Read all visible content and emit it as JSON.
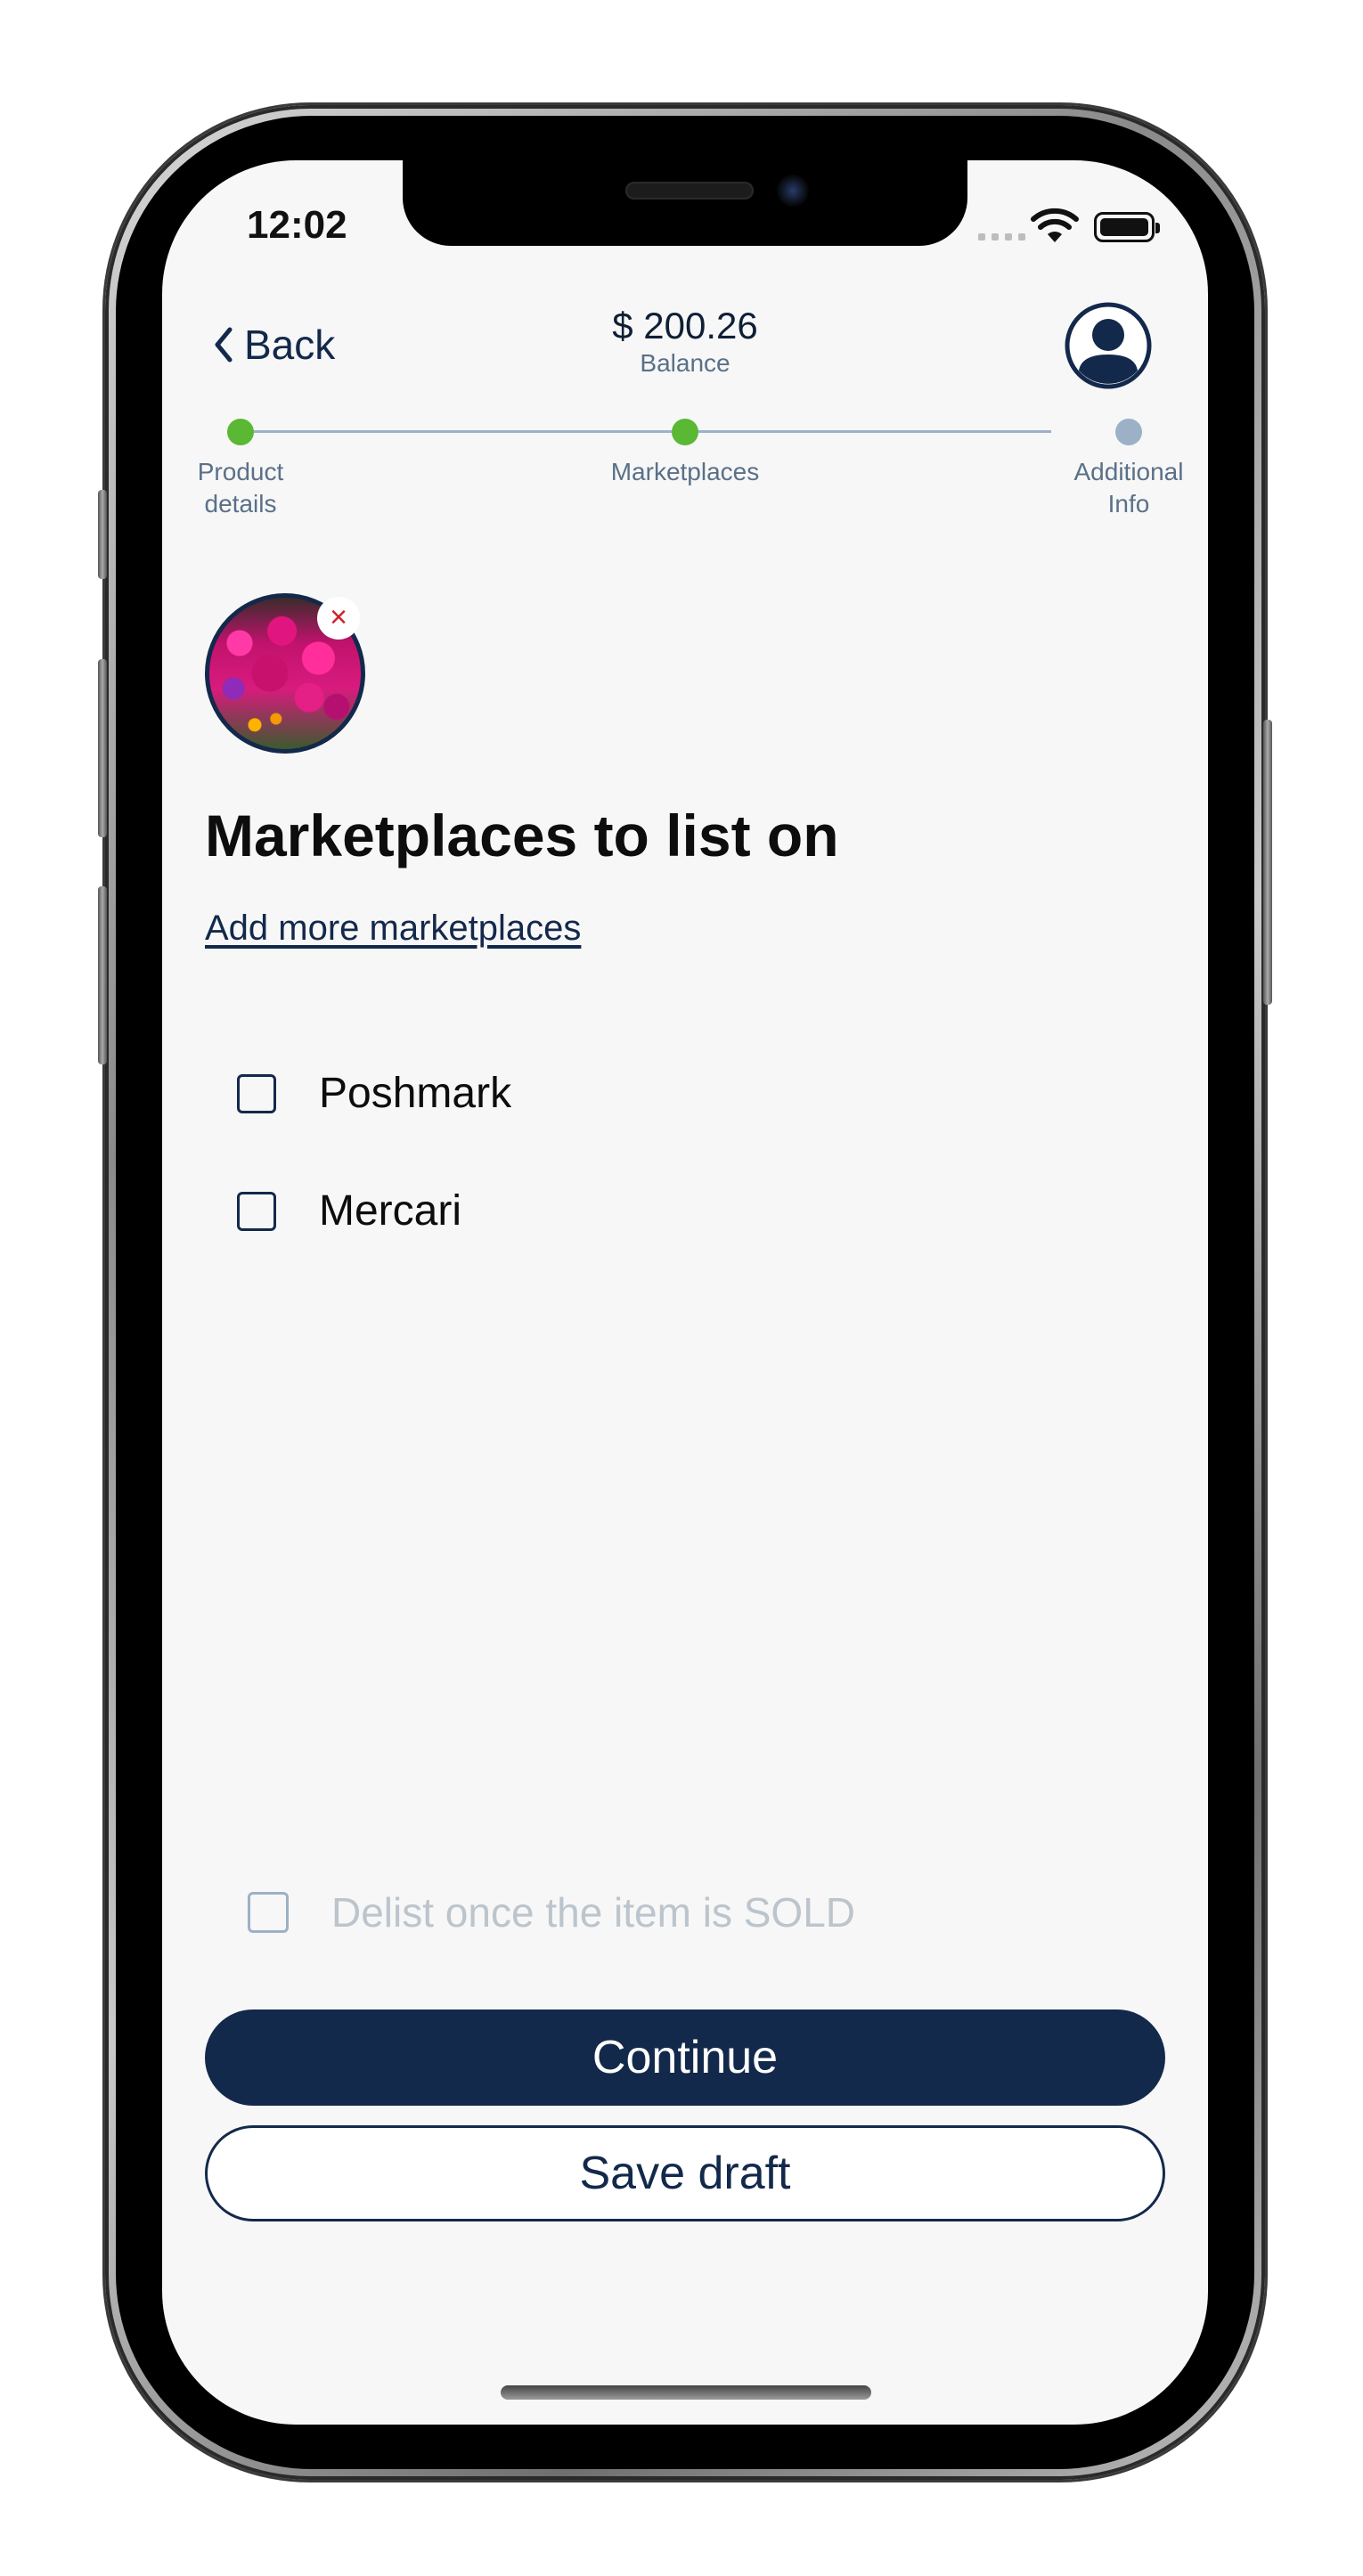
{
  "status_bar": {
    "time": "12:02"
  },
  "header": {
    "back_label": "Back",
    "balance_amount": "$ 200.26",
    "balance_label": "Balance",
    "profile_icon": "user-avatar-icon"
  },
  "stepper": {
    "steps": [
      {
        "label": "Product\ndetails",
        "state": "complete"
      },
      {
        "label": "Marketplaces",
        "state": "complete"
      },
      {
        "label": "Additional\nInfo",
        "state": "pending"
      }
    ],
    "complete_color": "#5ab834",
    "pending_color": "#9cb1c7"
  },
  "product": {
    "remove_symbol": "×"
  },
  "main": {
    "title": "Marketplaces to list on",
    "add_link": "Add more marketplaces",
    "marketplaces": [
      {
        "label": "Poshmark",
        "checked": false
      },
      {
        "label": "Mercari",
        "checked": false
      }
    ]
  },
  "footer": {
    "delist_label": "Delist once the item is SOLD",
    "delist_checked": false,
    "continue_label": "Continue",
    "save_draft_label": "Save draft"
  },
  "colors": {
    "primary": "#13294b",
    "background": "#f7f7f7",
    "muted_text": "#5a7088",
    "disabled_text": "#bcc4cc",
    "remove_x": "#d0202a"
  }
}
